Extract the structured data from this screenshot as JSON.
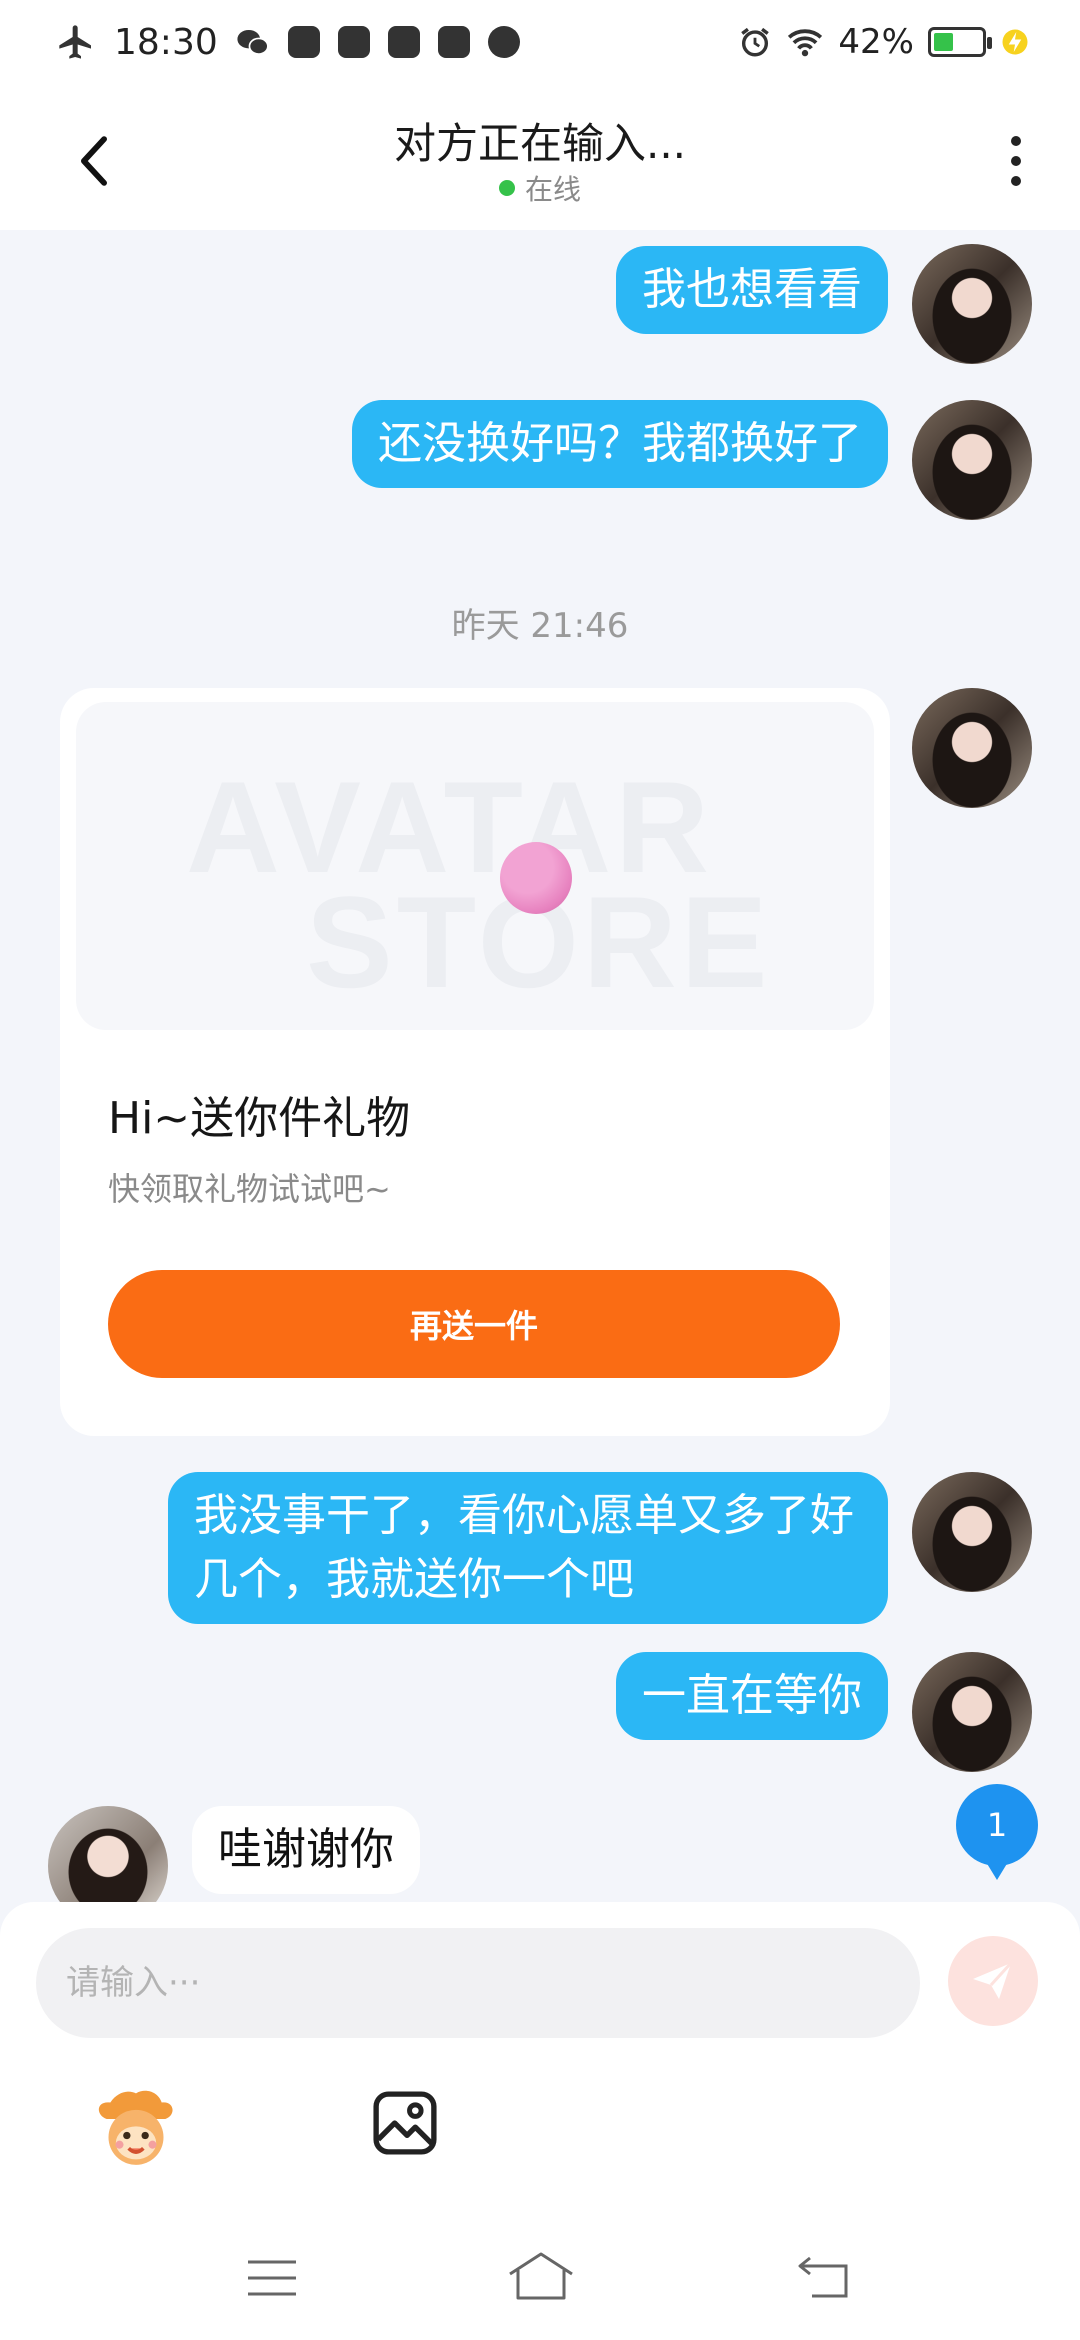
{
  "status_bar": {
    "time": "18:30",
    "battery": "42%",
    "battery_level": 0.42,
    "icons": [
      "airplane-mode-icon",
      "wechat-icon",
      "app-icon",
      "message-icon",
      "video-icon",
      "video-icon",
      "play-icon",
      "alarm-icon",
      "wifi-icon",
      "battery-icon",
      "charging-icon"
    ]
  },
  "header": {
    "title": "对方正在输入...",
    "status": "在线",
    "status_color": "#35c24a"
  },
  "messages": [
    {
      "side": "right",
      "type": "text",
      "text": "我也想看看"
    },
    {
      "side": "right",
      "type": "text",
      "text": "还没换好吗？我都换好了"
    },
    {
      "type": "timestamp",
      "text": "昨天 21:46"
    },
    {
      "side": "right",
      "type": "gift",
      "title": "Hi~送你件礼物",
      "subtitle": "快领取礼物试试吧~",
      "button": "再送一件",
      "watermark_line1": "AVATAR",
      "watermark_line2": "STORE"
    },
    {
      "side": "right",
      "type": "text",
      "text": "我没事干了，看你心愿单又多了好几个，我就送你一个吧"
    },
    {
      "side": "right",
      "type": "text",
      "text": "一直在等你"
    },
    {
      "side": "left",
      "type": "text",
      "text": "哇谢谢你"
    }
  ],
  "unread_count": "1",
  "input": {
    "placeholder": "请输入···"
  },
  "colors": {
    "bubble_self": "#2bb7f5",
    "gift_button": "#fa6c14",
    "badge": "#1e93f0"
  }
}
